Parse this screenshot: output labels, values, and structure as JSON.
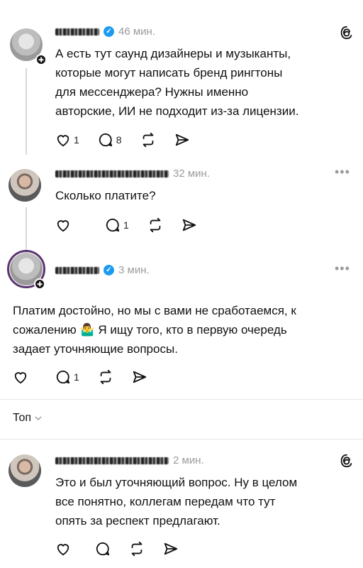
{
  "posts": [
    {
      "time": "46 мин.",
      "text_lines": [
        "А есть тут саунд дизайнеры и музыканты,",
        "которые могут написать бренд рингтоны",
        "для мессенджера? Нужны именно",
        "авторские, ИИ не подходит из-за лицензии."
      ],
      "likes": "1",
      "replies": "8"
    },
    {
      "time": "32 мин.",
      "text_lines": [
        "Сколько платите?"
      ],
      "likes": "",
      "replies": "1"
    },
    {
      "time": "3 мин.",
      "text_lines": [
        "Платим достойно, но мы с вами не сработаемся, к",
        "сожалению 🤷‍♂️ Я ищу того, кто в первую очередь",
        "задает уточняющие вопросы."
      ],
      "likes": "",
      "replies": "1"
    },
    {
      "time": "2 мин.",
      "text_lines": [
        "Это и был уточняющий вопрос. Ну в целом",
        "все понятно, коллегам передам что тут",
        "опять за респект предлагают."
      ],
      "likes": "",
      "replies": ""
    }
  ],
  "sort": {
    "label": "Топ"
  },
  "icons": {
    "like": "heart-icon",
    "reply": "comment-icon",
    "repost": "repost-icon",
    "share": "send-icon",
    "logo": "threads-logo-icon",
    "more": "more-dots-icon"
  },
  "colors": {
    "verified": "#1d9bf0",
    "meta": "#9b9b9b",
    "divider": "#e6e6e6"
  }
}
